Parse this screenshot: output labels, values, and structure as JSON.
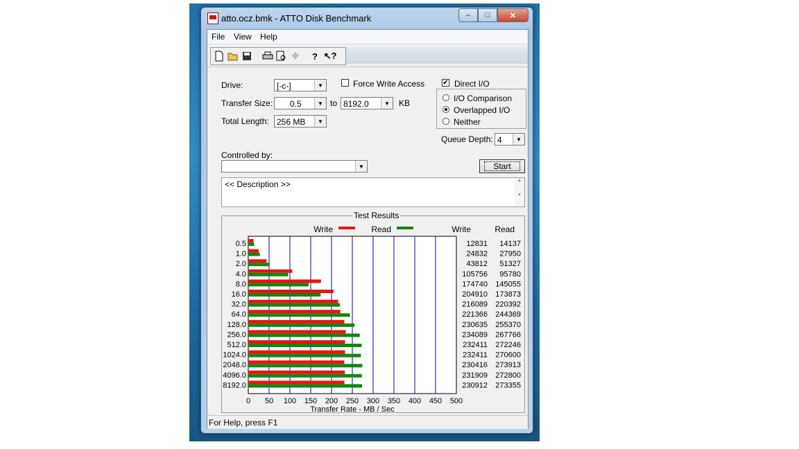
{
  "window": {
    "title": "atto.ocz.bmk - ATTO Disk Benchmark",
    "minimize": "‒",
    "maximize": "□",
    "close": "✕"
  },
  "menu": [
    "File",
    "View",
    "Help"
  ],
  "toolbar": {
    "icons": [
      "new-icon",
      "open-icon",
      "save-icon",
      "print-icon",
      "print-preview-icon",
      "move-icon",
      "help-icon",
      "context-help-icon"
    ]
  },
  "form": {
    "drive_label": "Drive:",
    "drive_value": "[-c-]",
    "force_write_label": "Force Write Access",
    "force_write_checked": false,
    "direct_io_label": "Direct I/O",
    "direct_io_checked": true,
    "transfer_size_label": "Transfer Size:",
    "transfer_from": "0.5",
    "to_label": "to",
    "transfer_to": "8192.0",
    "kb_label": "KB",
    "total_length_label": "Total Length:",
    "total_length_value": "256 MB",
    "io_comparison_label": "I/O Comparison",
    "overlapped_io_label": "Overlapped I/O",
    "neither_label": "Neither",
    "io_mode_selected": "Overlapped I/O",
    "queue_depth_label": "Queue Depth:",
    "queue_depth_value": "4",
    "controlled_by_label": "Controlled by:",
    "controlled_by_value": "",
    "start_label": "Start",
    "description": "<< Description >>"
  },
  "results": {
    "title": "Test Results",
    "write_label": "Write",
    "read_label": "Read",
    "col_write": "Write",
    "col_read": "Read",
    "xlabel": "Transfer Rate - MB / Sec",
    "colors": {
      "write": "#ee1111",
      "read": "#118811",
      "grid": "#0000c0"
    }
  },
  "chart_data": {
    "type": "bar",
    "orientation": "horizontal",
    "categories": [
      "0.5",
      "1.0",
      "2.0",
      "4.0",
      "8.0",
      "16.0",
      "32.0",
      "64.0",
      "128.0",
      "256.0",
      "512.0",
      "1024.0",
      "2048.0",
      "4096.0",
      "8192.0"
    ],
    "series": [
      {
        "name": "Write",
        "values": [
          12831,
          24832,
          43812,
          105756,
          174740,
          204910,
          216089,
          221366,
          230635,
          234089,
          232411,
          232411,
          230416,
          231909,
          230912
        ]
      },
      {
        "name": "Read",
        "values": [
          14137,
          27950,
          51327,
          95780,
          145055,
          173873,
          220392,
          244369,
          255370,
          267766,
          272246,
          270600,
          273913,
          272800,
          273355
        ]
      }
    ],
    "xlabel": "Transfer Rate - MB / Sec",
    "xticks": [
      "0",
      "50",
      "100",
      "150",
      "200",
      "250",
      "300",
      "350",
      "400",
      "450",
      "500"
    ],
    "xlim": [
      0,
      500
    ],
    "grid": true,
    "legend": "top"
  },
  "status": {
    "text": "For Help, press F1"
  }
}
